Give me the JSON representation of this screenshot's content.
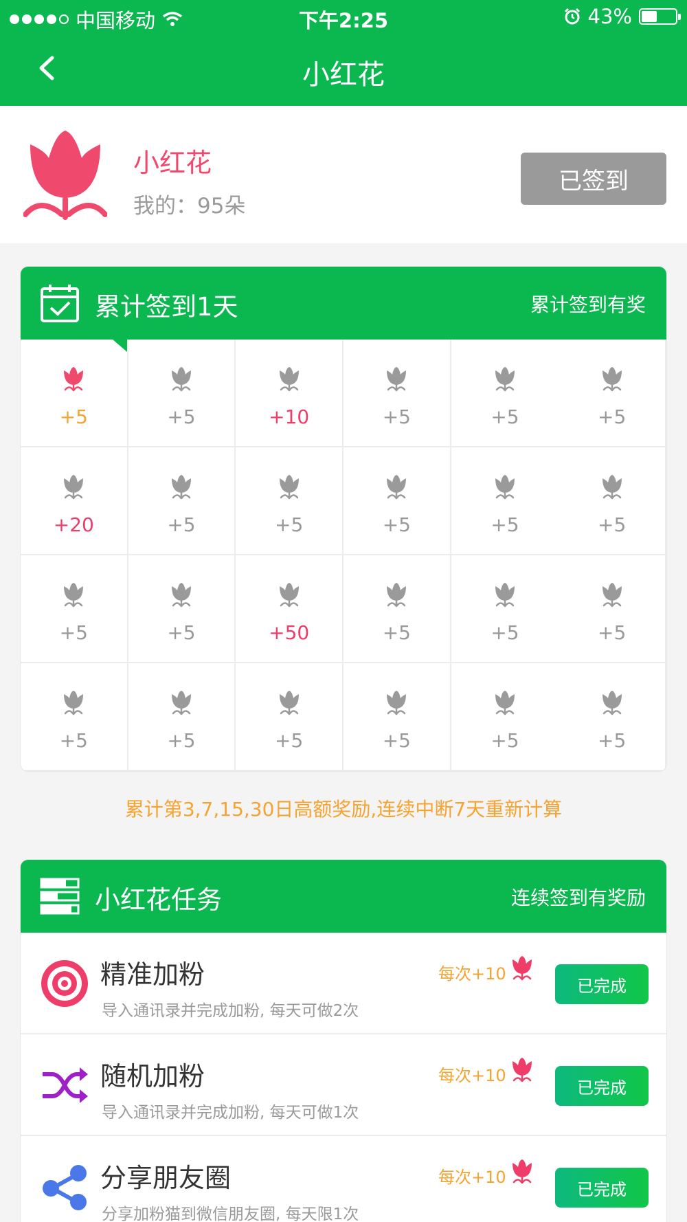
{
  "status_bar": {
    "carrier": "中国移动",
    "time": "下午2:25",
    "battery": "43%",
    "battery_level": 0.43,
    "signal_bars": 4
  },
  "nav": {
    "title": "小红花",
    "back_icon": "chevron-left-icon"
  },
  "profile": {
    "name": "小红花",
    "count_text": "我的：95朵",
    "signed_label": "已签到"
  },
  "checkin": {
    "title": "累计签到1天",
    "aside": "累计签到有奖",
    "days": [
      {
        "value": "+5",
        "color": "orange",
        "active": true
      },
      {
        "value": "+5"
      },
      {
        "value": "+10",
        "color": "pink"
      },
      {
        "value": "+5"
      },
      {
        "value": "+5"
      },
      {
        "value": "+5"
      },
      {
        "value": "+20",
        "color": "pink"
      },
      {
        "value": "+5"
      },
      {
        "value": "+5"
      },
      {
        "value": "+5"
      },
      {
        "value": "+5"
      },
      {
        "value": "+5"
      },
      {
        "value": "+5"
      },
      {
        "value": "+5"
      },
      {
        "value": "+50",
        "color": "pink"
      },
      {
        "value": "+5"
      },
      {
        "value": "+5"
      },
      {
        "value": "+5"
      },
      {
        "value": "+5"
      },
      {
        "value": "+5"
      },
      {
        "value": "+5"
      },
      {
        "value": "+5"
      },
      {
        "value": "+5"
      },
      {
        "value": "+5"
      }
    ],
    "notice": "累计第3,7,15,30日高额奖励,连续中断7天重新计算"
  },
  "tasks": {
    "title": "小红花任务",
    "aside": "连续签到有奖励",
    "items": [
      {
        "name": "精准加粉",
        "desc": "导入通讯录并完成加粉, 每天可做2次",
        "reward": "每次+10",
        "button": "已完成",
        "icon": "target-icon"
      },
      {
        "name": "随机加粉",
        "desc": "导入通讯录并完成加粉, 每天可做1次",
        "reward": "每次+10",
        "button": "已完成",
        "icon": "shuffle-icon"
      },
      {
        "name": "分享朋友圈",
        "desc": "分享加粉猫到微信朋友圈, 每天限1次",
        "reward": "每次+10",
        "button": "已完成",
        "icon": "share-icon"
      }
    ]
  },
  "colors": {
    "primary": "#0bb74f",
    "flower": "#ef4a6d",
    "grey_flower": "#9a9a9a",
    "accent_orange": "#f5a331"
  }
}
